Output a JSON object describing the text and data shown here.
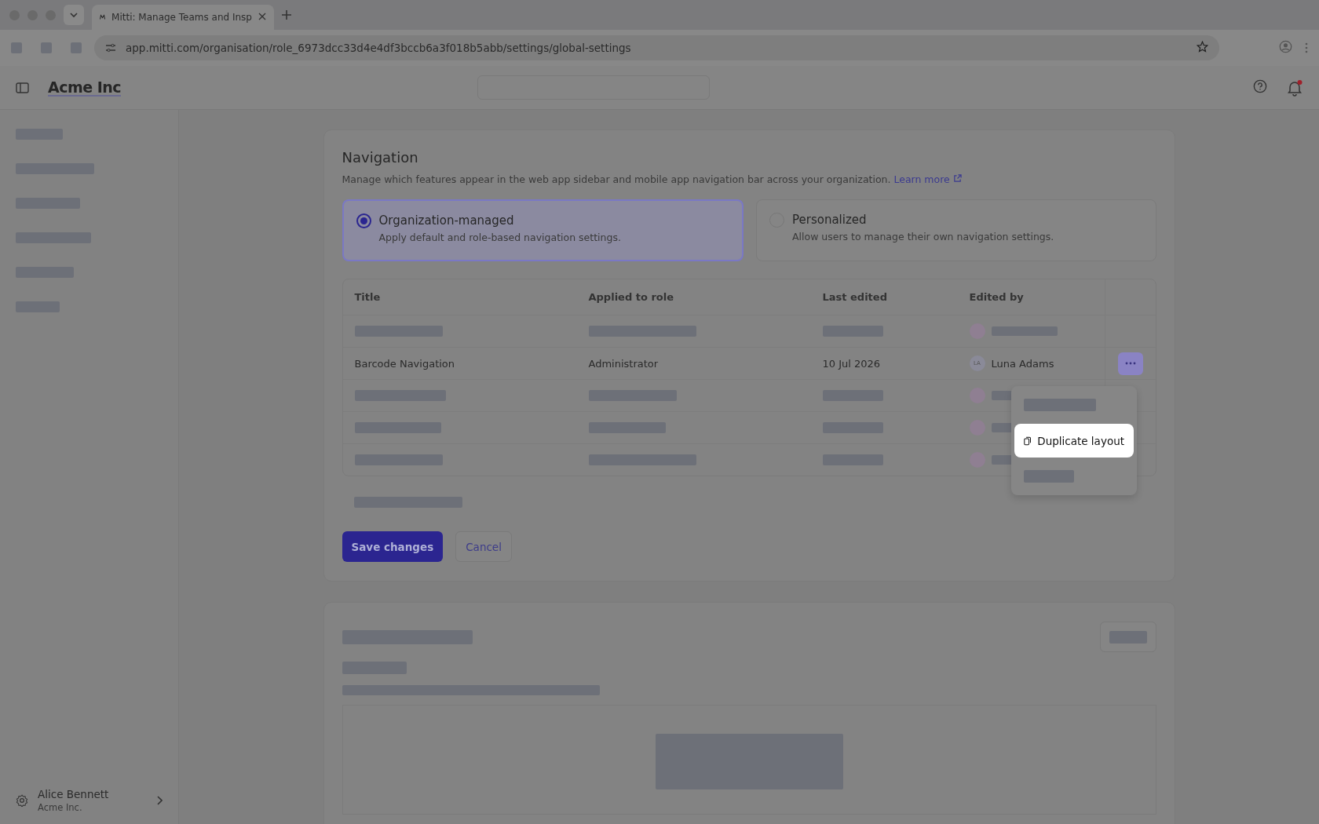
{
  "browser": {
    "tab_title": "Mitti: Manage Teams and Insp",
    "url": "app.mitti.com/organisation/role_6973dcc33d4e4df3bccb6a3f018b5abb/settings/global-settings"
  },
  "app": {
    "brand": "Acme Inc",
    "notifications_unread": true
  },
  "sidebar": {
    "user": {
      "name": "Alice Bennett",
      "org": "Acme Inc."
    }
  },
  "navigation": {
    "title": "Navigation",
    "description": "Manage which features appear in the web app sidebar and mobile app navigation bar across your organization.",
    "learn_more": "Learn more",
    "options": [
      {
        "title": "Organization-managed",
        "description": "Apply default and role-based navigation settings.",
        "selected": true
      },
      {
        "title": "Personalized",
        "description": "Allow users to manage their own navigation settings.",
        "selected": false
      }
    ],
    "table": {
      "columns": [
        "Title",
        "Applied to role",
        "Last edited",
        "Edited by"
      ],
      "rows": [
        {
          "loading": true
        },
        {
          "loading": false,
          "title": "Barcode Navigation",
          "role": "Administrator",
          "last_edited": "10 Jul 2026",
          "initials": "LA",
          "editor": "Luna Adams",
          "menu_open": true
        },
        {
          "loading": true
        },
        {
          "loading": true
        },
        {
          "loading": true
        }
      ]
    }
  },
  "menu": {
    "items": [
      {
        "kind": "skeleton"
      },
      {
        "kind": "action",
        "label": "Duplicate layout"
      },
      {
        "kind": "skeleton"
      }
    ]
  },
  "buttons": {
    "save": "Save changes",
    "cancel": "Cancel"
  }
}
